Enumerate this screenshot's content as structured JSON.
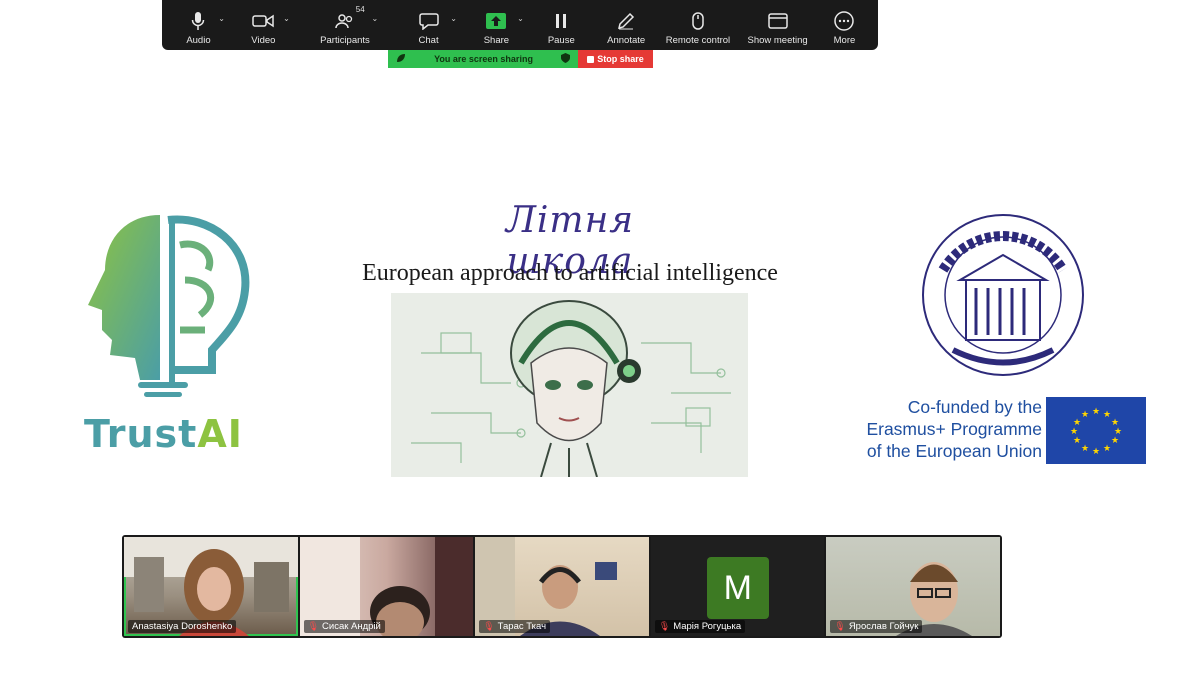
{
  "toolbar": {
    "items": [
      {
        "label": "Audio",
        "icon": "microphone-icon"
      },
      {
        "label": "Video",
        "icon": "video-camera-icon"
      },
      {
        "label": "Participants",
        "icon": "participants-icon",
        "count": "54"
      },
      {
        "label": "Chat",
        "icon": "chat-icon"
      },
      {
        "label": "Share",
        "icon": "share-screen-icon"
      },
      {
        "label": "Pause",
        "icon": "pause-icon"
      },
      {
        "label": "Annotate",
        "icon": "pencil-icon"
      },
      {
        "label": "Remote control",
        "icon": "mouse-icon"
      },
      {
        "label": "Show meeting",
        "icon": "window-icon"
      },
      {
        "label": "More",
        "icon": "more-dots-icon"
      }
    ],
    "accent": "#2fbf4f"
  },
  "share_bar": {
    "status": "You are screen sharing",
    "stop_label": "Stop share"
  },
  "slide": {
    "script_title": "Літня школа",
    "subtitle": "European approach to artificial intelligence",
    "trust_logo_part1": "Trust",
    "trust_logo_part2": "AI",
    "lviv_seal_text": "NATIONAL UNIVERSITY LVIV POLYTECHNIC 1816 LITTERIS ET ARTIBUS",
    "erasmus_lines": [
      "Co-funded by the",
      "Erasmus+ Programme",
      "of the European Union"
    ]
  },
  "participants": [
    {
      "name": "Anastasiya Doroshenko",
      "muted": false,
      "active": true
    },
    {
      "name": "Сисак Андрій",
      "muted": true,
      "active": false
    },
    {
      "name": "Тарас Ткач",
      "muted": true,
      "active": false
    },
    {
      "name": "Марія Рогуцька",
      "muted": true,
      "active": false,
      "avatar_letter": "M"
    },
    {
      "name": "Ярослав Гойчук",
      "muted": true,
      "active": false
    }
  ]
}
